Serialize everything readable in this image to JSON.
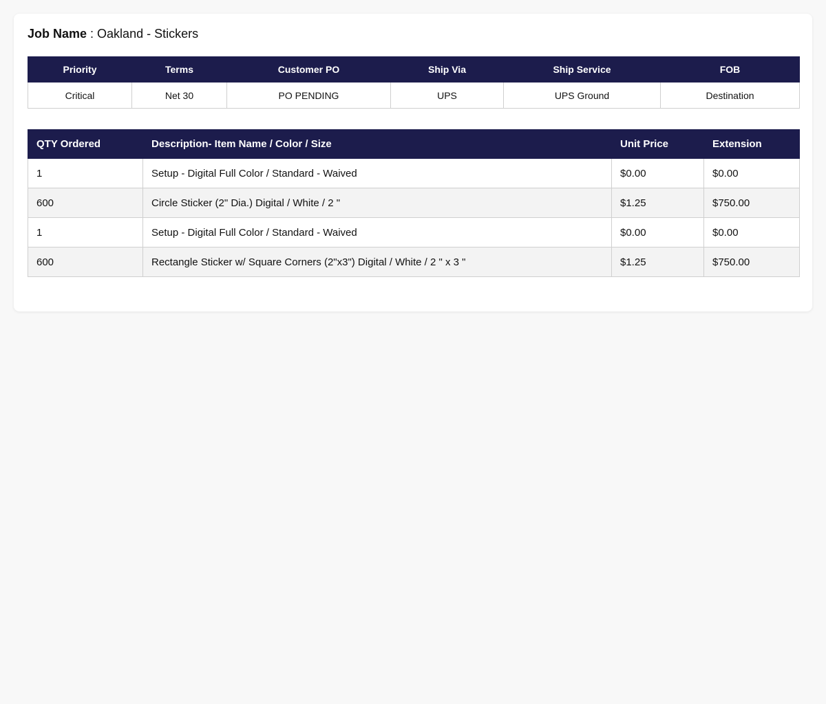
{
  "job": {
    "label": "Job Name",
    "separator": " : ",
    "value": "Oakland - Stickers"
  },
  "info": {
    "headers": [
      "Priority",
      "Terms",
      "Customer PO",
      "Ship Via",
      "Ship Service",
      "FOB"
    ],
    "values": [
      "Critical",
      "Net 30",
      "PO PENDING",
      "UPS",
      "UPS Ground",
      "Destination"
    ]
  },
  "items": {
    "headers": [
      "QTY Ordered",
      "Description- Item Name / Color / Size",
      "Unit Price",
      "Extension"
    ],
    "rows": [
      {
        "qty": "1",
        "description": "Setup - Digital Full Color / Standard - Waived",
        "unit_price": "$0.00",
        "extension": "$0.00"
      },
      {
        "qty": "600",
        "description": "Circle Sticker (2\" Dia.) Digital / White / 2 \"",
        "unit_price": "$1.25",
        "extension": "$750.00"
      },
      {
        "qty": "1",
        "description": "Setup - Digital Full Color / Standard - Waived",
        "unit_price": "$0.00",
        "extension": "$0.00"
      },
      {
        "qty": "600",
        "description": "Rectangle Sticker w/ Square Corners (2\"x3\") Digital / White / 2 \" x 3 \"",
        "unit_price": "$1.25",
        "extension": "$750.00"
      }
    ]
  },
  "colors": {
    "header_bg": "#1c1c4c",
    "header_text": "#ffffff",
    "row_alt_bg": "#f3f3f3",
    "page_bg": "#f8f8f8"
  }
}
